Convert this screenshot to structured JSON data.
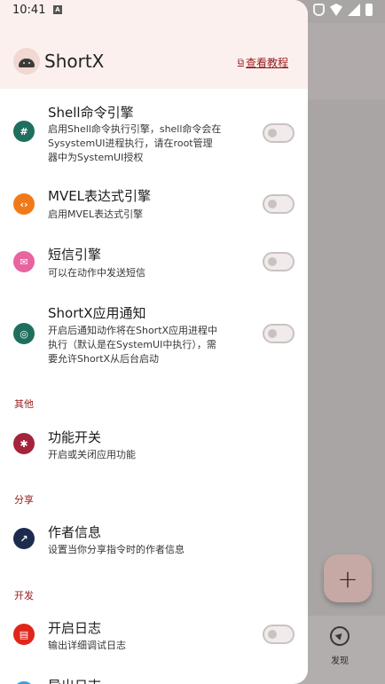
{
  "status_bar": {
    "time": "10:41",
    "a_badge": "A"
  },
  "drawer": {
    "app_name": "ShortX",
    "tutorial_link": "查看教程",
    "items": [
      {
        "title": "Shell命令引擎",
        "subtitle": "启用Shell命令执行引擎，shell命令会在SysystemUI进程执行，请在root管理器中为SystemUI授权",
        "icon": "hash-icon",
        "icon_color": "#1f6f5f",
        "toggle": false
      },
      {
        "title": "MVEL表达式引擎",
        "subtitle": "启用MVEL表达式引擎",
        "icon": "code-icon",
        "icon_color": "#f07a1a",
        "toggle": false
      },
      {
        "title": "短信引擎",
        "subtitle": "可以在动作中发送短信",
        "icon": "sms-icon",
        "icon_color": "#e8649f",
        "toggle": false
      },
      {
        "title": "ShortX应用通知",
        "subtitle": "开启后通知动作将在ShortX应用进程中执行（默认是在SystemUI中执行），需要允许ShortX从后台启动",
        "icon": "whatsapp-icon",
        "icon_color": "#1f6f5f",
        "toggle": false
      }
    ],
    "sections": {
      "other": {
        "label": "其他",
        "item": {
          "title": "功能开关",
          "subtitle": "开启或关闭应用功能",
          "icon": "puzzle-icon",
          "icon_color": "#a4243b"
        }
      },
      "share": {
        "label": "分享",
        "item": {
          "title": "作者信息",
          "subtitle": "设置当你分享指令时的作者信息",
          "icon": "external-link-icon",
          "icon_color": "#1d2b4d"
        }
      },
      "dev": {
        "label": "开发",
        "items": [
          {
            "title": "开启日志",
            "subtitle": "输出详细调试日志",
            "icon": "log-icon",
            "icon_color": "#e0261a",
            "toggle": false
          },
          {
            "title": "导出日志",
            "icon": "export-icon",
            "icon_color": "#3aa0d8"
          }
        ]
      }
    }
  },
  "background": {
    "fab_label": "+",
    "nav_discover": "发现"
  }
}
